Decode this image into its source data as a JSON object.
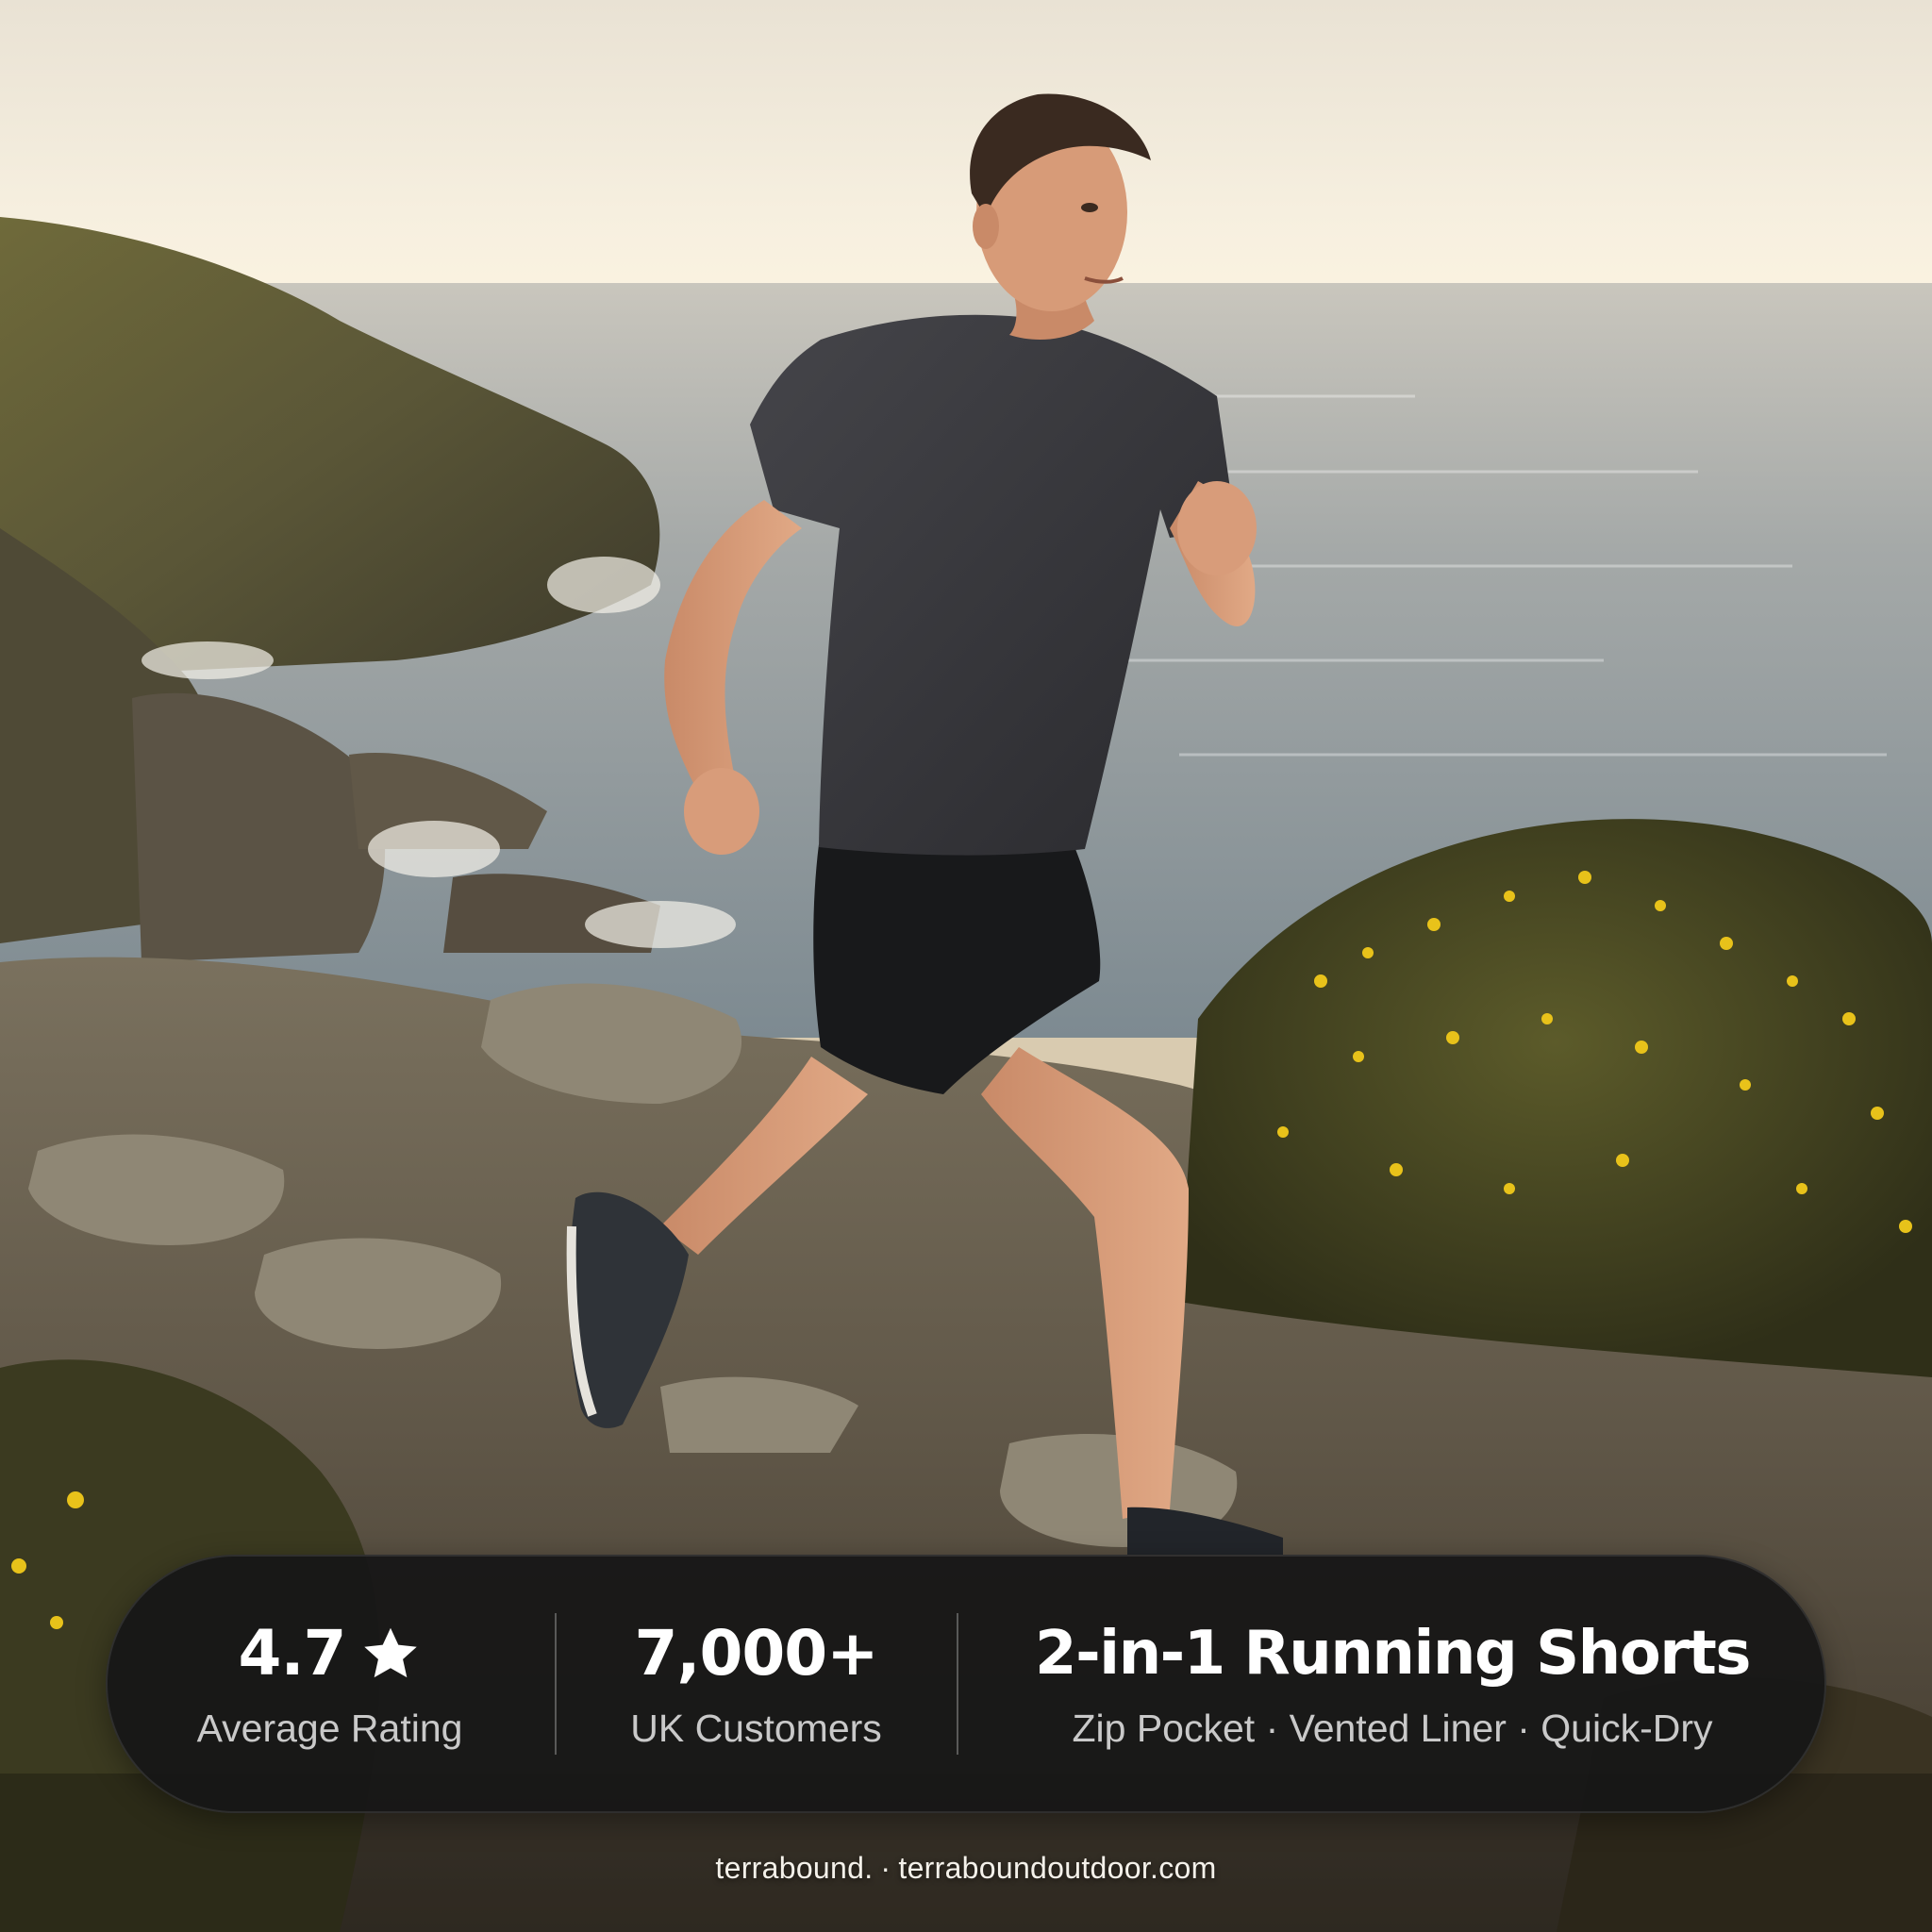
{
  "stats": {
    "rating": {
      "value": "4.7",
      "icon": "star-icon",
      "label": "Average Rating"
    },
    "customers": {
      "value": "7,000+",
      "label": "UK Customers"
    },
    "product": {
      "value": "2-in-1 Running Shorts",
      "label": "Zip Pocket · Vented Liner · Quick-Dry"
    }
  },
  "footer": {
    "brand": "terrabound.",
    "separator": "·",
    "url": "terraboundoutdoor.com"
  },
  "colors": {
    "pill_background": "#161616",
    "text_primary": "#ffffff",
    "text_secondary": "#c9c9c9",
    "sky": "#f3ecdc",
    "sea": "#8f9aa0",
    "gorse_flower": "#e8c21a"
  }
}
